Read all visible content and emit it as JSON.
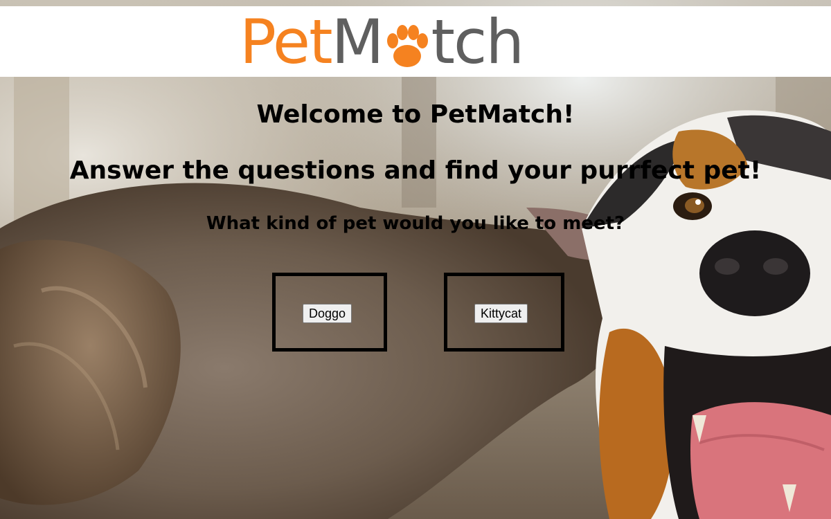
{
  "header": {
    "logo": {
      "part_pet": "Pet",
      "part_m": "M",
      "part_tch": "tch",
      "pet_color": "#f58220",
      "match_color": "#5f5f5f",
      "paw_icon": "paw-icon"
    }
  },
  "main": {
    "welcome_title": "Welcome to PetMatch!",
    "subtitle": "Answer the questions and find your purrfect pet!",
    "question": "What kind of pet would you like to meet?",
    "choices": [
      {
        "label": "Doggo"
      },
      {
        "label": "Kittycat"
      }
    ]
  },
  "background": {
    "image": "two dogs photo"
  }
}
